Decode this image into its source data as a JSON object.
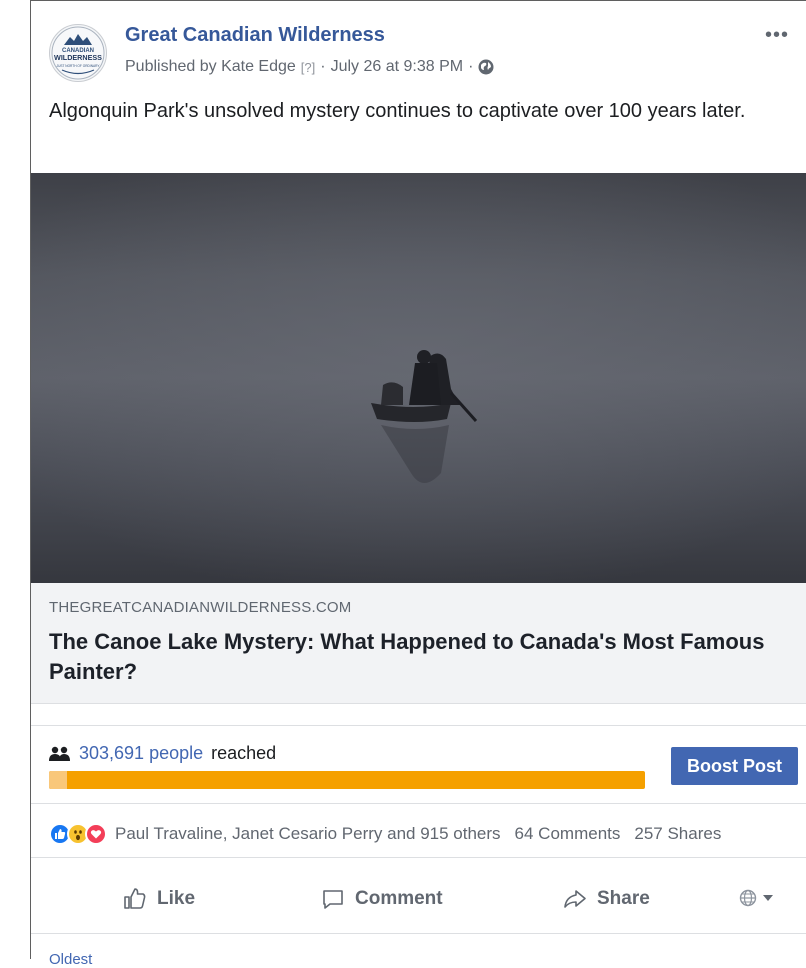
{
  "post": {
    "page_name": "Great Canadian Wilderness",
    "published_by": "Published by Kate Edge",
    "help_marker": "[?]",
    "separator": "·",
    "timestamp": "July 26 at 9:38 PM",
    "more_label": "•••",
    "caption": "Algonquin Park's unsolved mystery continues to captivate over 100 years later.",
    "avatar_text": [
      "CANADIAN",
      "WILDERNESS",
      "JUST NORTH OF ORDINARY"
    ]
  },
  "link": {
    "domain": "THEGREATCANADIANWILDERNESS.COM",
    "title": "The Canoe Lake Mystery: What Happened to Canada's Most Famous Painter?"
  },
  "insights": {
    "reach_count": "303,691 people",
    "reach_suffix": "reached",
    "boost_label": "Boost Post",
    "colors": {
      "bar": "#f5a000",
      "boost": "#4267b2"
    }
  },
  "reactions": {
    "names": "Paul Travaline, Janet Cesario Perry and 915 others",
    "comments": "64 Comments",
    "shares": "257 Shares",
    "icons": [
      "like-reaction-icon",
      "wow-reaction-icon",
      "love-reaction-icon"
    ]
  },
  "actions": {
    "like": "Like",
    "comment": "Comment",
    "share": "Share"
  },
  "footer_partial": "Oldest"
}
